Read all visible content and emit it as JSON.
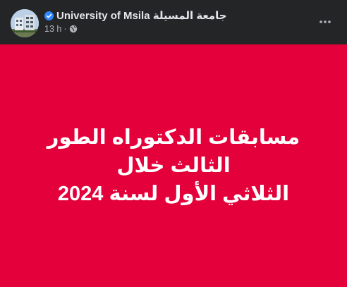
{
  "post": {
    "author": "University of Msila جامعة المسيلة",
    "timestamp": "13 h",
    "separator": "·",
    "verified": true,
    "privacy_icon": "globe-icon",
    "more_icon": "more-options-icon"
  },
  "card": {
    "background_color": "#e4003a",
    "text_color": "#ffffff",
    "line1": "مسابقات الدكتوراه الطور الثالث خلال",
    "line2": "الثلاثي الأول لسنة 2024"
  }
}
